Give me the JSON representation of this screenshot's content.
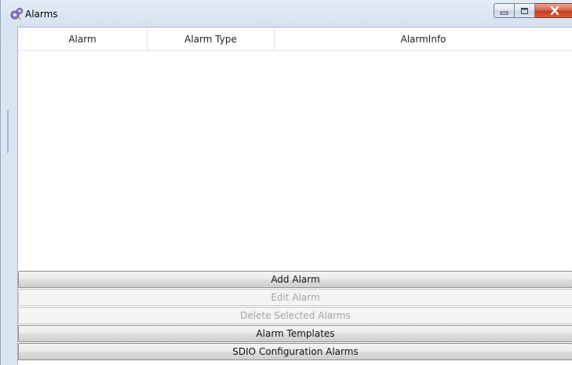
{
  "window": {
    "title": "Alarms",
    "icon": "gear-alarm-icon",
    "controls": [
      "minimize-icon",
      "maximize-icon",
      "close-icon"
    ]
  },
  "grid": {
    "columns": [
      "Alarm",
      "Alarm Type",
      "AlarmInfo"
    ],
    "rows": []
  },
  "buttons": {
    "add_alarm": "Add Alarm",
    "edit_alarm": "Edit Alarm",
    "delete_selected": "Delete Selected Alarms",
    "alarm_templates": "Alarm Templates",
    "sdio_config": "SDIO Configuration Alarms"
  },
  "colors": {
    "close_button": "#c43c1e",
    "disabled_text": "#a3a3a3"
  }
}
